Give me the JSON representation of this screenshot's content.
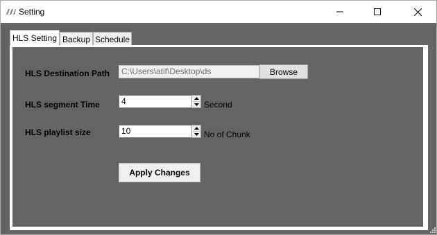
{
  "window": {
    "title": "Setting",
    "app_icon": "app-logo-icon"
  },
  "caption_buttons": {
    "minimize": "minimize-icon",
    "maximize": "maximize-icon",
    "close": "close-icon"
  },
  "tabs": [
    {
      "label": "HLS Setting",
      "active": true
    },
    {
      "label": "Backup",
      "active": false
    },
    {
      "label": "Schedule",
      "active": false
    }
  ],
  "form": {
    "destination": {
      "label": "HLS Destination Path",
      "value": "C:\\Users\\atif\\Desktop\\ds",
      "browse_label": "Browse"
    },
    "segment_time": {
      "label": "HLS segment Time",
      "value": "4",
      "unit": "Second"
    },
    "playlist_size": {
      "label": "HLS playlist size",
      "value": "10",
      "unit": "No of Chunk"
    },
    "apply_label": "Apply Changes"
  },
  "colors": {
    "background": "#646464",
    "titlebar": "#ffffff",
    "panel_border": "#ffffff"
  }
}
